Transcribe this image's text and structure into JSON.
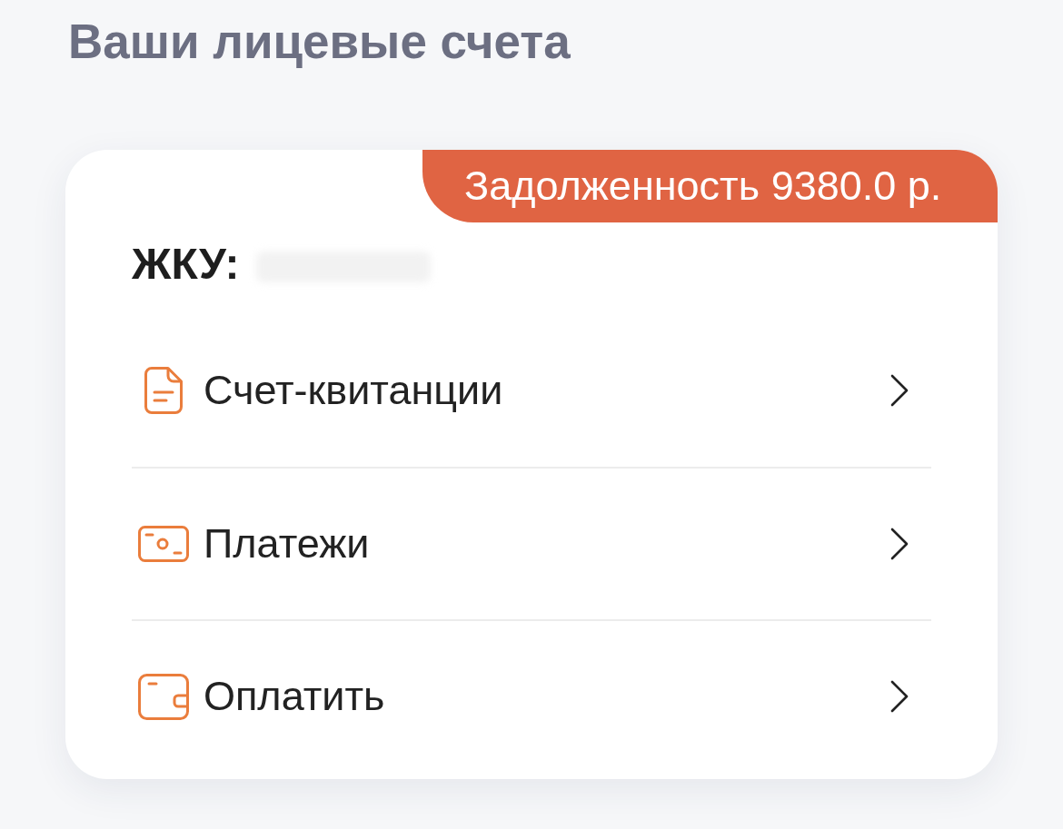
{
  "title": "Ваши лицевые счета",
  "account": {
    "debt_badge": "Задолженность 9380.0 р.",
    "label": "ЖКУ:"
  },
  "menu": [
    {
      "kind": "document",
      "label": "Счет-квитанции"
    },
    {
      "kind": "payments",
      "label": "Платежи"
    },
    {
      "kind": "wallet",
      "label": "Оплатить"
    }
  ]
}
